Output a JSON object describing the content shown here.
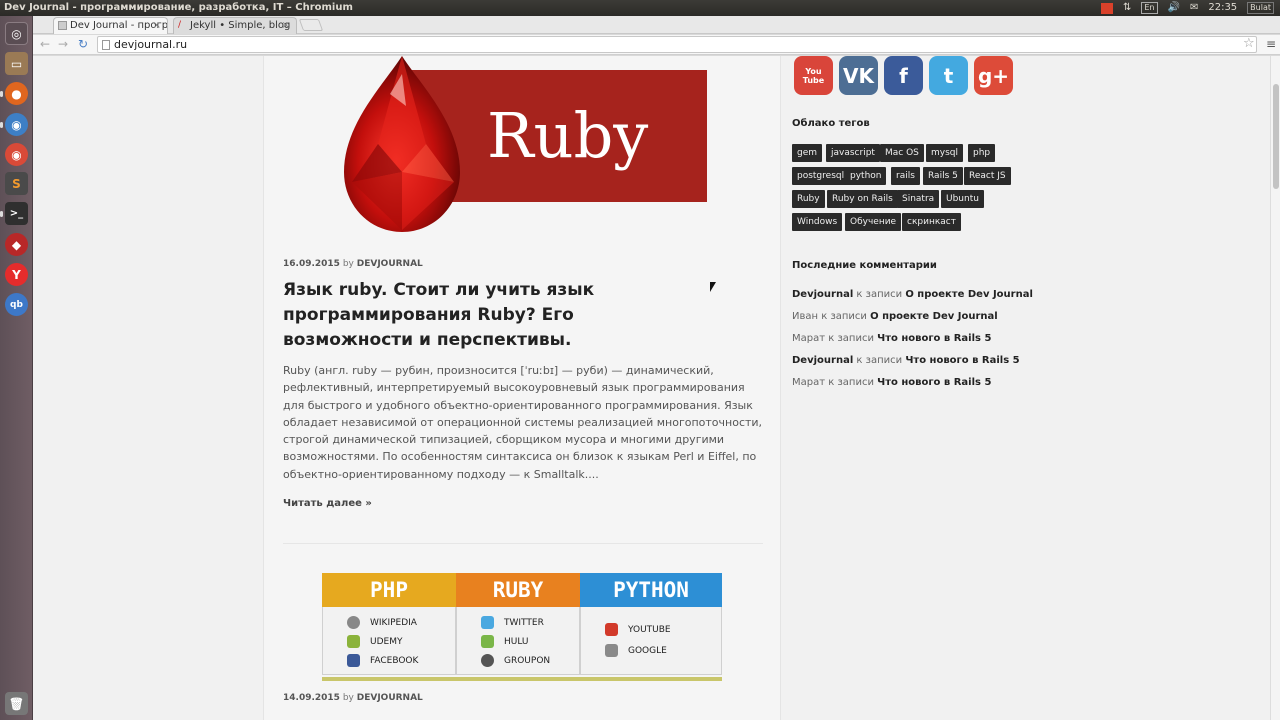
{
  "os": {
    "window_title": "Dev Journal - программирование, разработка, IT – Chromium",
    "keyboard_layout": "En",
    "clock": "22:35",
    "user": "Bulat"
  },
  "launcher": {
    "icons": [
      "ubuntu-dash-icon",
      "files-icon",
      "firefox-icon",
      "chromium-icon",
      "chrome-icon",
      "sublime-icon",
      "terminal-icon",
      "ruby-app-icon",
      "yandex-icon",
      "qbittorrent-icon",
      "trash-icon"
    ]
  },
  "browser": {
    "tabs": [
      {
        "title": "Dev Journal - програ",
        "active": true
      },
      {
        "title": "Jekyll • Simple, blog",
        "active": false
      }
    ],
    "url": "devjournal.ru"
  },
  "post1": {
    "hero_text": "Ruby",
    "date": "16.09.2015",
    "by": "by",
    "author": "DEVJOURNAL",
    "title": "Язык ruby. Стоит ли учить язык программирования Ruby? Его возможности и перспективы.",
    "excerpt": "Ruby (англ. ruby — рубин, произносится [ˈruːbɪ] — руби) — динамический, рефлективный, интерпретируемый высокоуровневый язык программирования для быстрого и удобного объектно-ориентированного программирования. Язык обладает независимой от операционной системы реализацией многопоточности, строгой динамической типизацией, сборщиком мусора и многими другими возможностями. По особенностям синтаксиса он близок к языкам Perl и Eiffel, по объектно-ориентированному подходу — к Smalltalk....",
    "read_more": "Читать далее »"
  },
  "post2": {
    "columns": [
      {
        "name": "PHP",
        "color": "#e6a91f",
        "items": [
          {
            "label": "WIKIPEDIA",
            "icon": "wikipedia-icon",
            "color": "#888888"
          },
          {
            "label": "UDEMY",
            "icon": "udemy-icon",
            "color": "#8bb33b"
          },
          {
            "label": "FACEBOOK",
            "icon": "facebook-icon",
            "color": "#3b5998"
          }
        ]
      },
      {
        "name": "RUBY",
        "color": "#e8811f",
        "items": [
          {
            "label": "TWITTER",
            "icon": "twitter-icon",
            "color": "#4aa8e0"
          },
          {
            "label": "HULU",
            "icon": "hulu-icon",
            "color": "#7ab648"
          },
          {
            "label": "GROUPON",
            "icon": "groupon-icon",
            "color": "#555555"
          }
        ]
      },
      {
        "name": "PYTHON",
        "color": "#2d8fd5",
        "items": [
          {
            "label": "YOUTUBE",
            "icon": "youtube-icon",
            "color": "#d23a2a"
          },
          {
            "label": "GOOGLE",
            "icon": "google-icon",
            "color": "#8a8a8a"
          }
        ]
      }
    ],
    "date": "14.09.2015",
    "by": "by",
    "author": "DEVJOURNAL"
  },
  "sidebar": {
    "social": [
      {
        "name": "youtube-social-icon",
        "label": "You Tube",
        "color": "#d9453a"
      },
      {
        "name": "vk-social-icon",
        "label": "VK",
        "color": "#4d6e94"
      },
      {
        "name": "facebook-social-icon",
        "label": "f",
        "color": "#3b5b9a"
      },
      {
        "name": "twitter-social-icon",
        "label": "t",
        "color": "#43a9e0"
      },
      {
        "name": "googleplus-social-icon",
        "label": "g+",
        "color": "#dd4b39"
      }
    ],
    "tags_title": "Облако тегов",
    "tags": [
      "gem",
      "javascript",
      "Mac OS",
      "mysql",
      "php",
      "postgresql",
      "python",
      "rails",
      "Rails 5",
      "React JS",
      "Ruby",
      "Ruby on Rails",
      "Sinatra",
      "Ubuntu",
      "Windows",
      "Обучение",
      "скринкаст"
    ],
    "comments_title": "Последние комментарии",
    "comments": [
      {
        "author": "Devjournal",
        "author_bold": true,
        "joiner": "к записи",
        "post": "О проекте Dev Journal"
      },
      {
        "author": "Иван",
        "author_bold": false,
        "joiner": "к записи",
        "post": "О проекте Dev Journal"
      },
      {
        "author": "Марат",
        "author_bold": false,
        "joiner": "к записи",
        "post": "Что нового в Rails 5"
      },
      {
        "author": "Devjournal",
        "author_bold": true,
        "joiner": "к записи",
        "post": "Что нового в Rails 5"
      },
      {
        "author": "Марат",
        "author_bold": false,
        "joiner": "к записи",
        "post": "Что нового в Rails 5"
      }
    ]
  }
}
